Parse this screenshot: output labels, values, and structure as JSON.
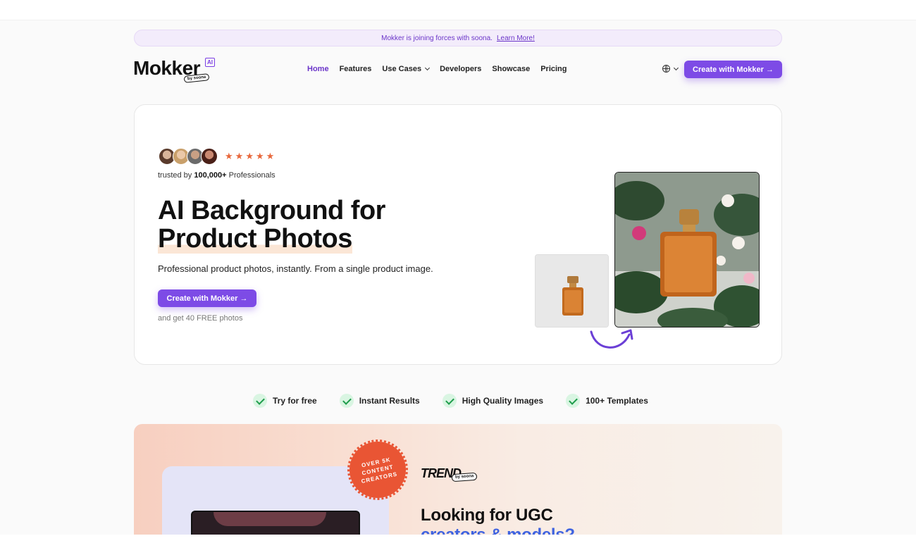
{
  "announcement": {
    "text": "Mokker is joining forces with soona.",
    "link": "Learn More!"
  },
  "logo": {
    "name": "Mokker",
    "badge": "AI",
    "tagline": "by soona"
  },
  "nav": {
    "items": [
      "Home",
      "Features",
      "Use Cases",
      "Developers",
      "Showcase",
      "Pricing"
    ],
    "cta": "Create with Mokker →"
  },
  "hero": {
    "trusted_prefix": "trusted by",
    "trusted_count": "100,000+",
    "trusted_suffix": "Professionals",
    "title_line1": "AI Background for",
    "title_line2": "Product Photos",
    "subtitle": "Professional product photos, instantly. From a single product image.",
    "cta": "Create with Mokker →",
    "note": "and get 40 FREE photos",
    "stars": 5
  },
  "features": [
    "Try for free",
    "Instant Results",
    "High Quality Images",
    "100+ Templates"
  ],
  "promo": {
    "badge_line1": "OVER 5K",
    "badge_line2": "CONTENT",
    "badge_line3": "CREATORS",
    "brand": "TREND",
    "brand_tagline": "by soona",
    "title_line1": "Looking for UGC",
    "title_line2": "creators & models?"
  },
  "colors": {
    "accent": "#7d4be6",
    "star": "#e8683c",
    "check": "#1f9d4c",
    "badge": "#e95534"
  }
}
